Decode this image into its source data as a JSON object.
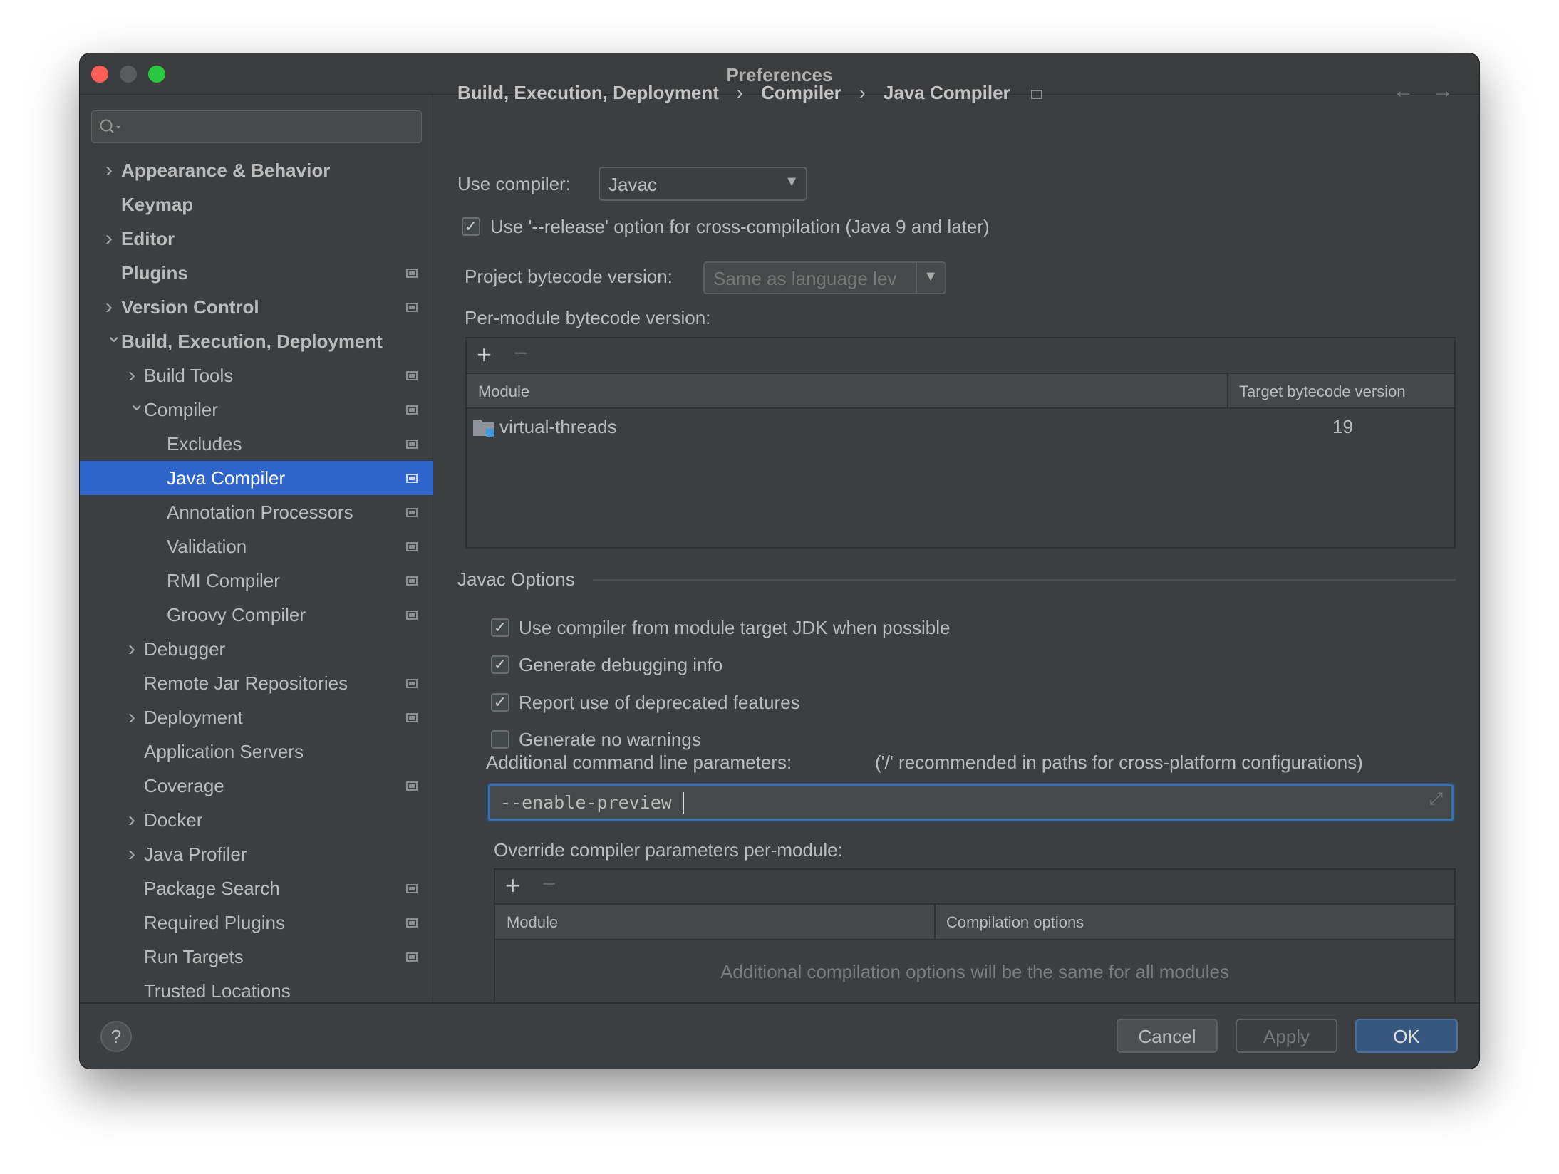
{
  "window": {
    "title": "Preferences"
  },
  "search": {
    "placeholder": ""
  },
  "sidebar": {
    "items": [
      {
        "label": "Appearance & Behavior",
        "level": 0,
        "chevron": "right",
        "pin": false,
        "bold": true
      },
      {
        "label": "Keymap",
        "level": 0,
        "chevron": "none",
        "pin": false,
        "bold": true
      },
      {
        "label": "Editor",
        "level": 0,
        "chevron": "right",
        "pin": false,
        "bold": true
      },
      {
        "label": "Plugins",
        "level": 0,
        "chevron": "none",
        "pin": true,
        "bold": true
      },
      {
        "label": "Version Control",
        "level": 0,
        "chevron": "right",
        "pin": true,
        "bold": true
      },
      {
        "label": "Build, Execution, Deployment",
        "level": 0,
        "chevron": "down",
        "pin": false,
        "bold": true
      },
      {
        "label": "Build Tools",
        "level": 1,
        "chevron": "right",
        "pin": true
      },
      {
        "label": "Compiler",
        "level": 1,
        "chevron": "down",
        "pin": true
      },
      {
        "label": "Excludes",
        "level": 2,
        "chevron": "none",
        "pin": true
      },
      {
        "label": "Java Compiler",
        "level": 2,
        "chevron": "none",
        "pin": true,
        "selected": true
      },
      {
        "label": "Annotation Processors",
        "level": 2,
        "chevron": "none",
        "pin": true
      },
      {
        "label": "Validation",
        "level": 2,
        "chevron": "none",
        "pin": true
      },
      {
        "label": "RMI Compiler",
        "level": 2,
        "chevron": "none",
        "pin": true
      },
      {
        "label": "Groovy Compiler",
        "level": 2,
        "chevron": "none",
        "pin": true
      },
      {
        "label": "Debugger",
        "level": 1,
        "chevron": "right",
        "pin": false
      },
      {
        "label": "Remote Jar Repositories",
        "level": 1,
        "chevron": "none",
        "pin": true
      },
      {
        "label": "Deployment",
        "level": 1,
        "chevron": "right",
        "pin": true
      },
      {
        "label": "Application Servers",
        "level": 1,
        "chevron": "none",
        "pin": false
      },
      {
        "label": "Coverage",
        "level": 1,
        "chevron": "none",
        "pin": true
      },
      {
        "label": "Docker",
        "level": 1,
        "chevron": "right",
        "pin": false
      },
      {
        "label": "Java Profiler",
        "level": 1,
        "chevron": "right",
        "pin": false
      },
      {
        "label": "Package Search",
        "level": 1,
        "chevron": "none",
        "pin": true
      },
      {
        "label": "Required Plugins",
        "level": 1,
        "chevron": "none",
        "pin": true
      },
      {
        "label": "Run Targets",
        "level": 1,
        "chevron": "none",
        "pin": true
      },
      {
        "label": "Trusted Locations",
        "level": 1,
        "chevron": "none",
        "pin": false
      }
    ]
  },
  "breadcrumb": [
    "Build, Execution, Deployment",
    "Compiler",
    "Java Compiler"
  ],
  "main": {
    "use_compiler_label": "Use compiler:",
    "use_compiler_value": "Javac",
    "release_option": {
      "label": "Use '--release' option for cross-compilation (Java 9 and later)",
      "checked": true
    },
    "project_bytecode_label": "Project bytecode version:",
    "project_bytecode_value": "Same as language lev",
    "per_module_label": "Per-module bytecode version:",
    "per_module_table": {
      "columns": [
        "Module",
        "Target bytecode version"
      ],
      "rows": [
        {
          "module": "virtual-threads",
          "version": "19"
        }
      ]
    },
    "javac_options_title": "Javac Options",
    "options": [
      {
        "label": "Use compiler from module target JDK when possible",
        "checked": true
      },
      {
        "label": "Generate debugging info",
        "checked": true
      },
      {
        "label": "Report use of deprecated features",
        "checked": true
      },
      {
        "label": "Generate no warnings",
        "checked": false
      }
    ],
    "additional_label": "Additional command line parameters:",
    "additional_hint": "('/' recommended in paths for cross-platform configurations)",
    "additional_value": "--enable-preview",
    "override_label": "Override compiler parameters per-module:",
    "override_table": {
      "columns": [
        "Module",
        "Compilation options"
      ],
      "empty_text": "Additional compilation options will be the same for all modules"
    }
  },
  "footer": {
    "help": "?",
    "cancel": "Cancel",
    "apply": "Apply",
    "ok": "OK"
  },
  "colors": {
    "selection": "#2f65ca",
    "ok_button": "#365880",
    "focus": "#3d6fa8"
  }
}
